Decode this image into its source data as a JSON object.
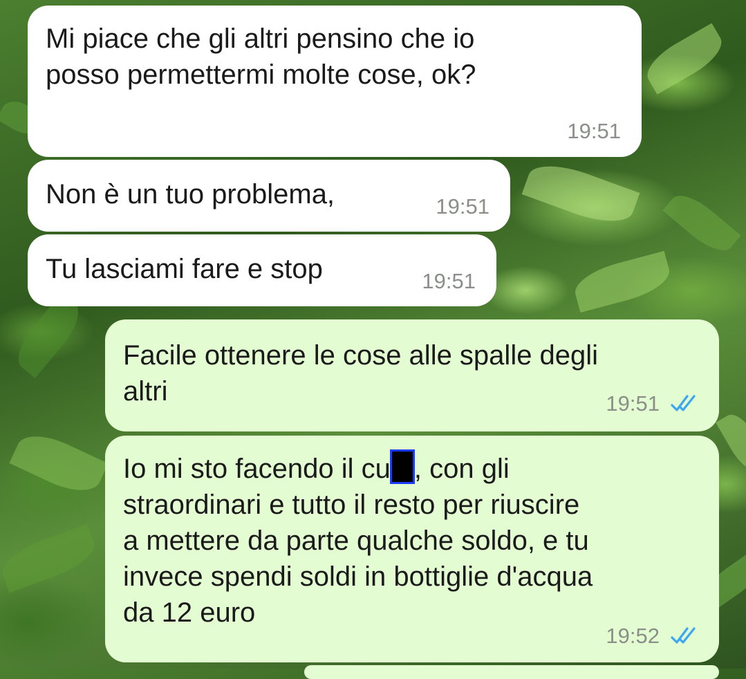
{
  "colors": {
    "incoming_bubble": "#ffffff",
    "outgoing_bubble": "#e3fcd1",
    "read_ticks": "#3aa7f0",
    "time_text": "#8a8f8a"
  },
  "messages": [
    {
      "direction": "incoming",
      "text": "Mi piace che gli altri pensino che io\nposso permettermi molte cose, ok?",
      "time": "19:51"
    },
    {
      "direction": "incoming",
      "text": "Non è un tuo problema,",
      "time": "19:51"
    },
    {
      "direction": "incoming",
      "text": "Tu lasciami fare e stop",
      "time": "19:51"
    },
    {
      "direction": "outgoing",
      "text": "Facile ottenere le cose alle spalle degli\naltri",
      "time": "19:51",
      "status_icon": "double-check-icon"
    },
    {
      "direction": "outgoing",
      "text_before_redaction": "Io mi sto facendo il cu",
      "text_after_redaction": ", con gli\nstraordinari e tutto il resto per riuscire\na mettere da parte qualche soldo, e tu\ninvece spendi soldi in bottiglie d'acqua\nda 12 euro",
      "time": "19:52",
      "status_icon": "double-check-icon"
    }
  ]
}
